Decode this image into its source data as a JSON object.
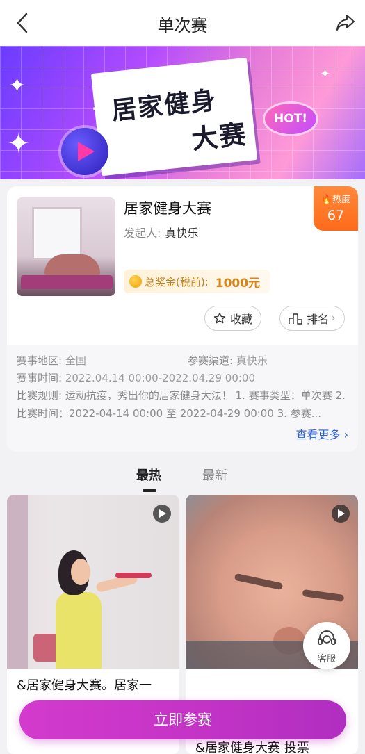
{
  "nav": {
    "title": "单次赛",
    "back_icon": "chevron-left-icon",
    "share_icon": "share-icon"
  },
  "banner": {
    "title_line1": "居家健身",
    "title_line2": "大赛",
    "badge": "HOT!",
    "colors": {
      "start": "#6a3cff",
      "mid": "#e67bd8",
      "end": "#a56cff"
    }
  },
  "contest": {
    "name": "居家健身大赛",
    "initiator_label": "发起人:",
    "initiator": "真快乐",
    "heat_label": "热度",
    "heat_value": "67",
    "prize_label": "总奖金(税前):",
    "prize_value": "1000元",
    "collect_label": "收藏",
    "rank_label": "排名",
    "region_label": "赛事地区:",
    "region": "全国",
    "channel_label": "参赛渠道:",
    "channel": "真快乐",
    "time_label": "赛事时间:",
    "time": "2022.04.14 00:00-2022.04.29 00:00",
    "rules_label": "比赛规则:",
    "rules": "运动抗疫，秀出你的居家健身大法！ 1. 赛事类型：单次赛 2. 比赛时间：2022-04-14 00:00 至 2022-04-29 00:00 3. 参赛...",
    "more_label": "查看更多"
  },
  "tabs": [
    {
      "label": "最热"
    },
    {
      "label": "最新"
    }
  ],
  "feed": [
    {
      "caption": "&居家健身大赛。居家一"
    },
    {
      "caption": "&居家健身大赛 投票"
    }
  ],
  "service": {
    "label": "客服"
  },
  "cta": {
    "label": "立即参赛"
  },
  "accent_colors": {
    "cta": "#c534c7",
    "heat": "#ff6a1a",
    "link": "#2d5fd6",
    "prize": "#d4861a"
  }
}
